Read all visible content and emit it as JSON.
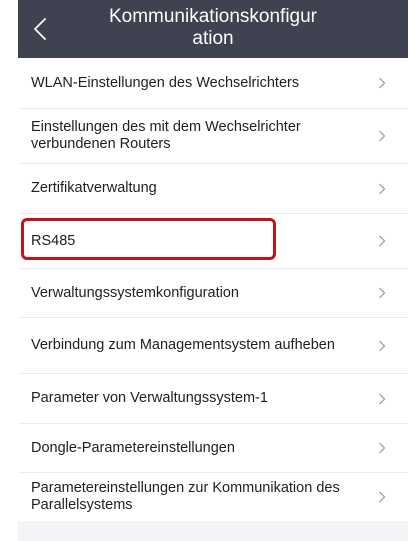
{
  "header": {
    "title": "Kommunikationskonfigur\nation",
    "back_icon": "chevron-left-icon"
  },
  "colors": {
    "header_bg": "#3f4250",
    "highlight_border": "#c0141b"
  },
  "list": {
    "chevron_icon": "chevron-right-icon",
    "items": [
      {
        "label": "WLAN-Einstellungen des Wechselrichters"
      },
      {
        "label": "Einstellungen des mit dem Wechselrichter verbundenen Routers"
      },
      {
        "label": "Zertifikatverwaltung"
      },
      {
        "label": "RS485"
      },
      {
        "label": "Verwaltungssystemkonfiguration"
      },
      {
        "label": "Verbindung zum Managementsystem aufheben"
      },
      {
        "label": "Parameter von Verwaltungssystem-1"
      },
      {
        "label": "Dongle-Parametereinstellungen"
      },
      {
        "label": "Parametereinstellungen zur Kommunikation des Parallelsystems"
      }
    ]
  }
}
